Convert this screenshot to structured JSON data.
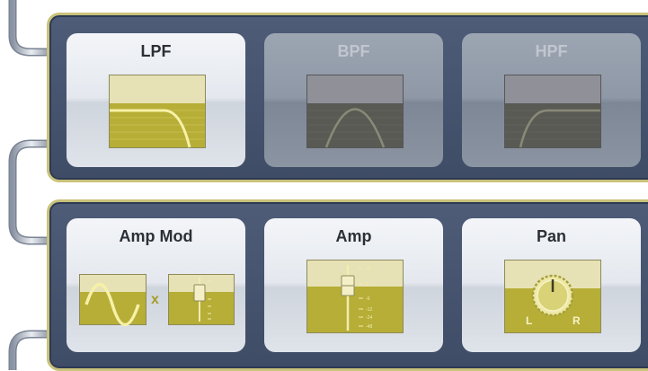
{
  "filter_section": {
    "cards": [
      {
        "label": "LPF",
        "state": "selected",
        "icon": "lowpass-curve-icon"
      },
      {
        "label": "BPF",
        "state": "unselected",
        "icon": "bandpass-curve-icon"
      },
      {
        "label": "HPF",
        "state": "unselected",
        "icon": "highpass-curve-icon"
      }
    ]
  },
  "modulation_section": {
    "amp_mod": {
      "label": "Amp Mod",
      "multiply_sign": "x",
      "icons": [
        "sine-wave-icon",
        "fader-icon"
      ]
    },
    "amp": {
      "label": "Amp",
      "icon": "volume-fader-icon",
      "scale_labels": [
        "+6",
        "0",
        "-6",
        "-12",
        "-24",
        "-48"
      ]
    },
    "pan": {
      "label": "Pan",
      "icon": "pan-knob-icon",
      "left_label": "L",
      "right_label": "R"
    }
  },
  "colors": {
    "panel_border": "#c9c27a",
    "panel_fill": "#46536d",
    "display_active": "#b8b03a",
    "display_inactive": "#5b5c55"
  }
}
